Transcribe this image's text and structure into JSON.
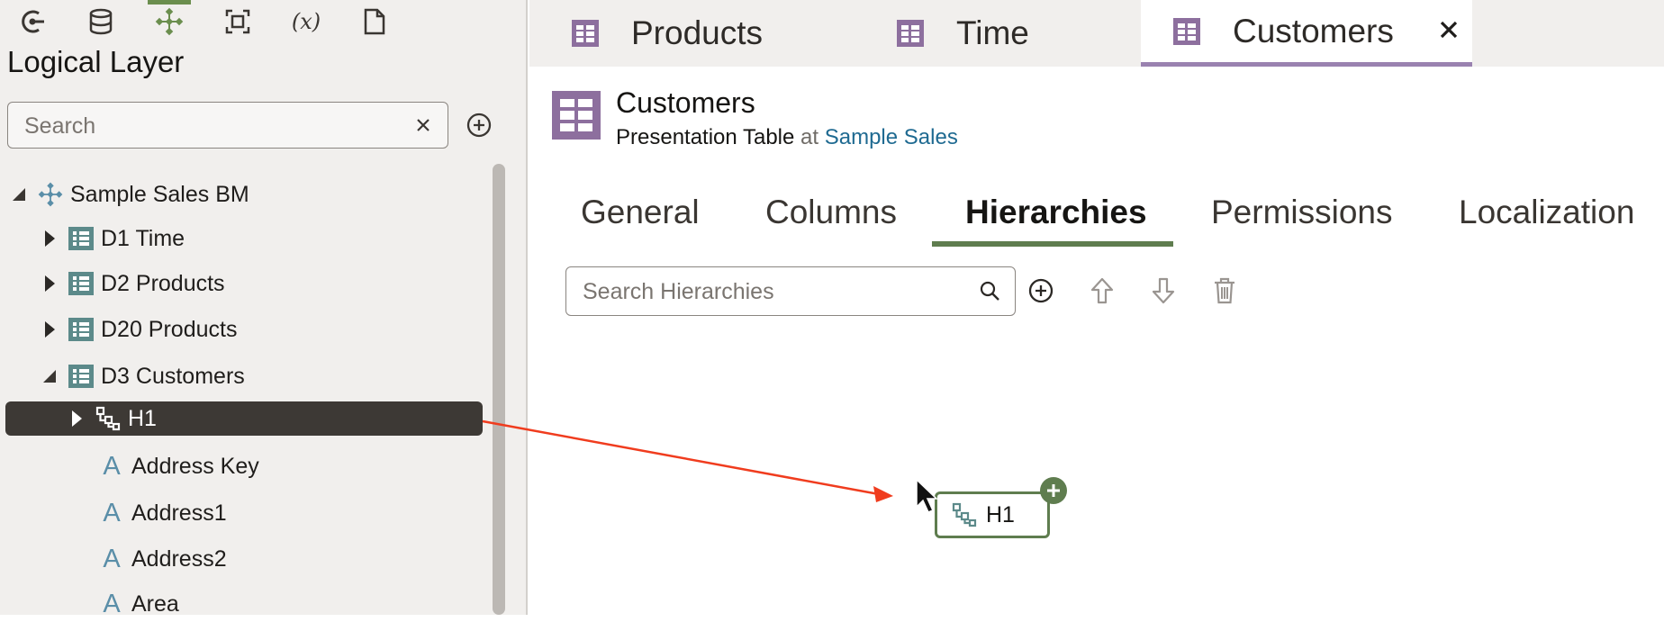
{
  "sidebar": {
    "toolbar_icons": [
      "connections-icon",
      "database-icon",
      "model-icon",
      "physical-layer-icon",
      "variables-icon",
      "document-icon"
    ],
    "title": "Logical Layer",
    "search_placeholder": "Search",
    "tree": {
      "root": "Sample Sales BM",
      "items": [
        {
          "label": "D1 Time",
          "expanded": false
        },
        {
          "label": "D2 Products",
          "expanded": false
        },
        {
          "label": "D20 Products",
          "expanded": false
        },
        {
          "label": "D3 Customers",
          "expanded": true
        }
      ],
      "selected": "H1",
      "attributes": [
        "Address Key",
        "Address1",
        "Address2",
        "Area"
      ]
    }
  },
  "tabs": [
    {
      "label": "Products"
    },
    {
      "label": "Time"
    },
    {
      "label": "Customers",
      "active": true
    }
  ],
  "object": {
    "title": "Customers",
    "type": "Presentation Table",
    "at": "at",
    "location": "Sample Sales"
  },
  "section_tabs": [
    {
      "label": "General"
    },
    {
      "label": "Columns"
    },
    {
      "label": "Hierarchies",
      "active": true
    },
    {
      "label": "Permissions"
    },
    {
      "label": "Localization"
    }
  ],
  "hierarchies": {
    "search_placeholder": "Search Hierarchies"
  },
  "drag": {
    "chip_label": "H1"
  },
  "colors": {
    "accent_green": "#5f7d4f",
    "tab_purple": "#9a82b0",
    "table_icon": "#8d6f9e",
    "arrow_red": "#f03c1e",
    "link_blue": "#1f6a91"
  }
}
